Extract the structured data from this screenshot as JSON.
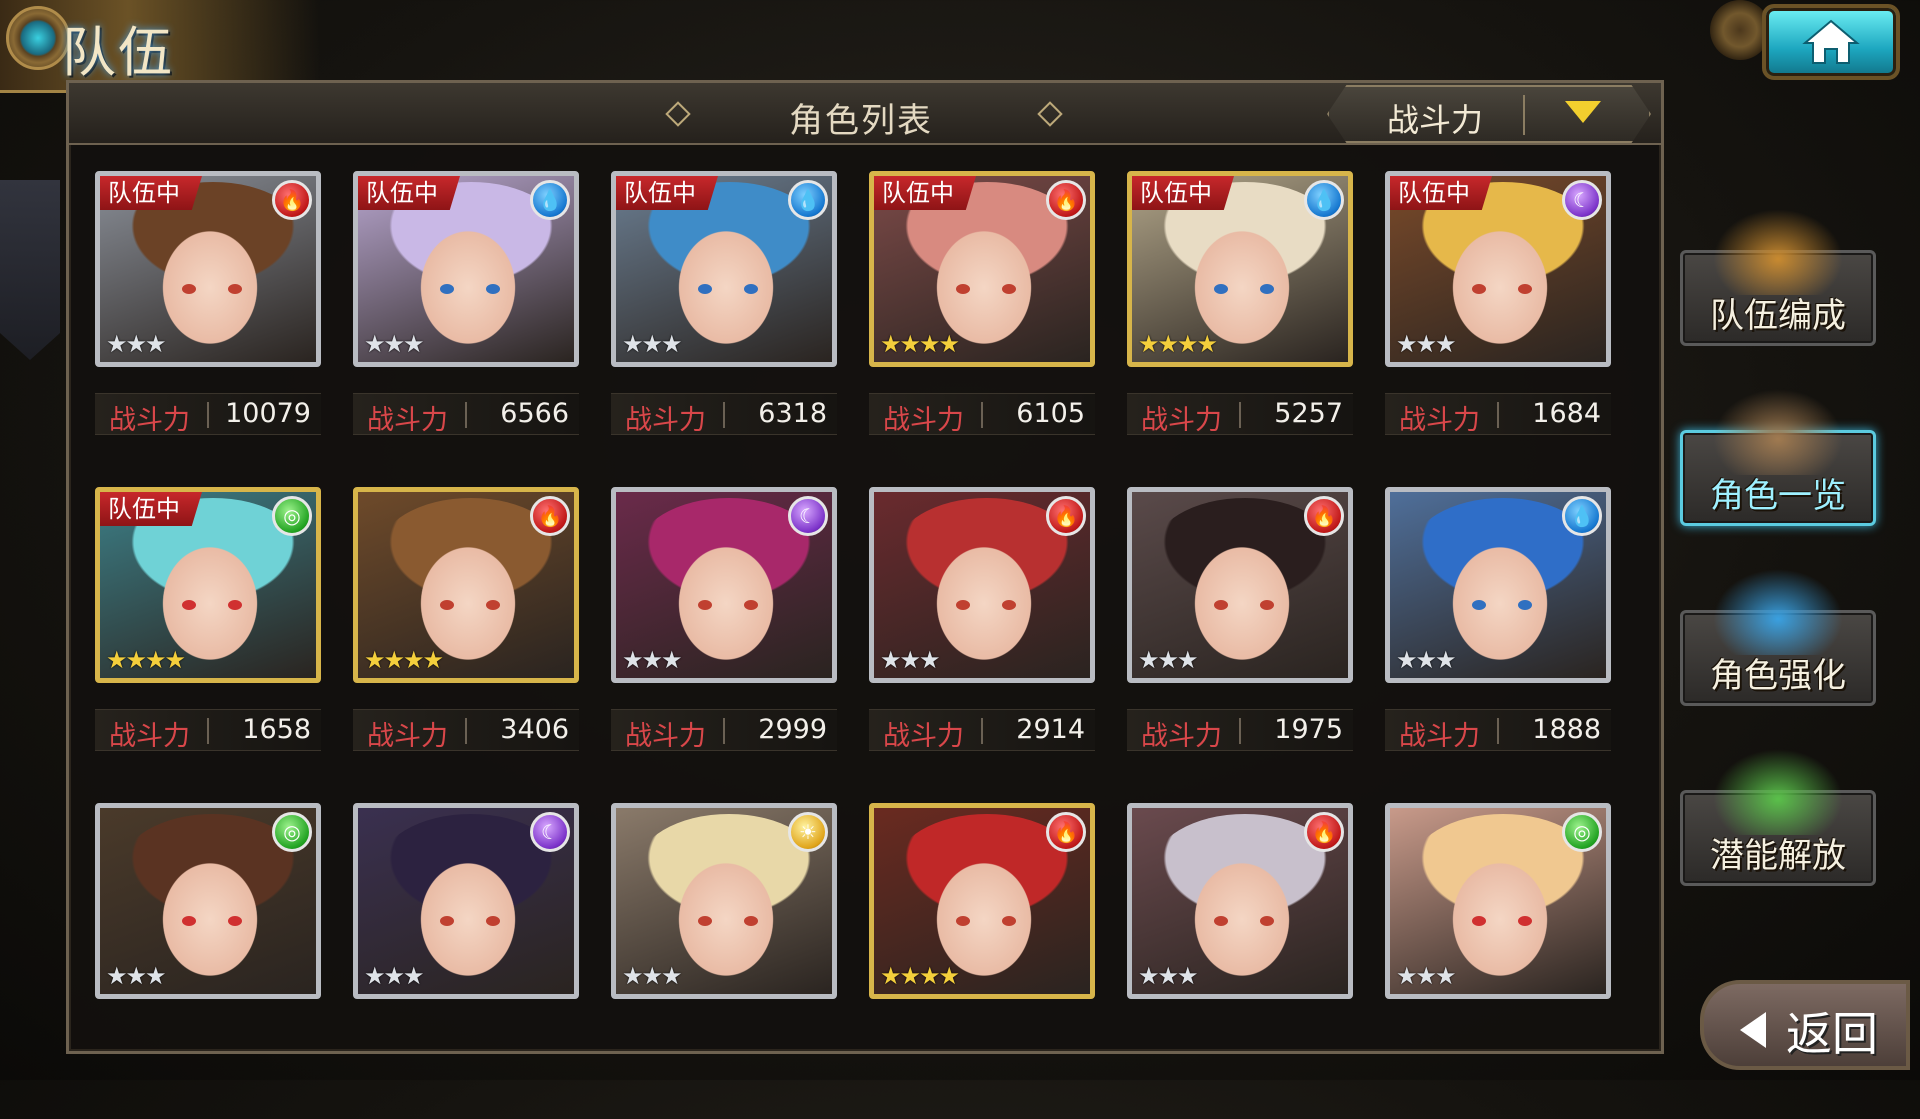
{
  "header": {
    "title": "队伍"
  },
  "panel": {
    "list_title": "角色列表",
    "sort": {
      "selected": "战斗力"
    }
  },
  "power_label": "战斗力",
  "in_team_label": "队伍中",
  "characters": [
    {
      "in_team": true,
      "element": "fire",
      "rarity": 3,
      "frame": "silver",
      "power": "10079",
      "hair": "#6b4226",
      "bg": "#8a8f98"
    },
    {
      "in_team": true,
      "element": "water",
      "rarity": 3,
      "frame": "silver",
      "power": "6566",
      "hair": "#c9b8e6",
      "bg": "#b8a6cf"
    },
    {
      "in_team": true,
      "element": "water",
      "rarity": 3,
      "frame": "silver",
      "power": "6318",
      "hair": "#3f8cc8",
      "bg": "#6b7e92"
    },
    {
      "in_team": true,
      "element": "fire",
      "rarity": 4,
      "frame": "gold",
      "power": "6105",
      "hair": "#d88a80",
      "bg": "#7c4a48"
    },
    {
      "in_team": true,
      "element": "water",
      "rarity": 4,
      "frame": "gold",
      "power": "5257",
      "hair": "#e8dcc4",
      "bg": "#b0a488"
    },
    {
      "in_team": true,
      "element": "dark",
      "rarity": 3,
      "frame": "silver",
      "power": "1684",
      "hair": "#e6b84a",
      "bg": "#7a4a2a"
    },
    {
      "in_team": true,
      "element": "wind",
      "rarity": 4,
      "frame": "gold",
      "power": "1658",
      "hair": "#6fd2d6",
      "bg": "#3c7e86"
    },
    {
      "in_team": false,
      "element": "fire",
      "rarity": 4,
      "frame": "gold",
      "power": "3406",
      "hair": "#8a5a30",
      "bg": "#6e4a2a"
    },
    {
      "in_team": false,
      "element": "dark",
      "rarity": 3,
      "frame": "silver",
      "power": "2999",
      "hair": "#a8286a",
      "bg": "#6a2a4a"
    },
    {
      "in_team": false,
      "element": "fire",
      "rarity": 3,
      "frame": "silver",
      "power": "2914",
      "hair": "#b83030",
      "bg": "#6a2a2e"
    },
    {
      "in_team": false,
      "element": "fire",
      "rarity": 3,
      "frame": "silver",
      "power": "1975",
      "hair": "#2a1e1e",
      "bg": "#5a4a4a"
    },
    {
      "in_team": false,
      "element": "water",
      "rarity": 3,
      "frame": "silver",
      "power": "1888",
      "hair": "#2f6ec8",
      "bg": "#4f6f9a"
    },
    {
      "in_team": false,
      "element": "wind",
      "rarity": 3,
      "frame": "silver",
      "power": "",
      "hair": "#5a3322",
      "bg": "#4a3a2a"
    },
    {
      "in_team": false,
      "element": "dark",
      "rarity": 3,
      "frame": "silver",
      "power": "",
      "hair": "#2c2240",
      "bg": "#3a3050"
    },
    {
      "in_team": false,
      "element": "light",
      "rarity": 3,
      "frame": "silver",
      "power": "",
      "hair": "#e8d8a8",
      "bg": "#8a7a6a"
    },
    {
      "in_team": false,
      "element": "fire",
      "rarity": 4,
      "frame": "gold",
      "power": "",
      "hair": "#c02828",
      "bg": "#6a2a20"
    },
    {
      "in_team": false,
      "element": "fire",
      "rarity": 3,
      "frame": "silver",
      "power": "",
      "hair": "#c8c0cc",
      "bg": "#6a4a4e"
    },
    {
      "in_team": false,
      "element": "wind",
      "rarity": 3,
      "frame": "silver",
      "power": "",
      "hair": "#f0c890",
      "bg": "#c89a8a"
    }
  ],
  "side_menu": [
    {
      "label": "队伍编成",
      "active": false,
      "art": "#c88a30"
    },
    {
      "label": "角色一览",
      "active": true,
      "art": "#a07a50"
    },
    {
      "label": "角色强化",
      "active": false,
      "art": "#3aa0e0"
    },
    {
      "label": "潜能解放",
      "active": false,
      "art": "#5ac04a"
    }
  ],
  "back_label": "返回"
}
